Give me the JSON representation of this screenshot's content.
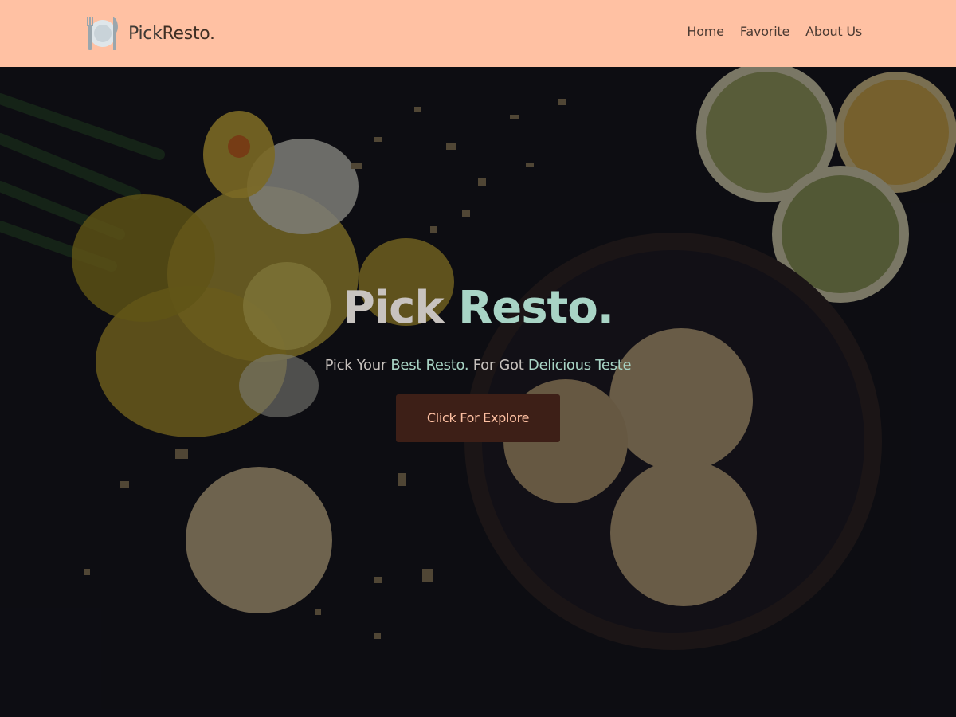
{
  "header": {
    "brand_pick": "Pick",
    "brand_resto": "Resto",
    "brand_dot": ".",
    "nav": [
      {
        "label": "Home"
      },
      {
        "label": "Favorite"
      },
      {
        "label": "About Us"
      }
    ],
    "background_color": "#ffc1a3"
  },
  "hero": {
    "title_part1": "Pick",
    "title_part2": "Resto.",
    "subtitle_1": "Pick Your",
    "subtitle_2": "Best Resto.",
    "subtitle_3": "For Got",
    "subtitle_4": "Delicious Teste",
    "cta_label": "Click For Explore",
    "accent_color": "#a8d4c5",
    "cta_color": "#3d1f17"
  },
  "icons": {
    "logo": "plate-fork-knife-icon"
  }
}
